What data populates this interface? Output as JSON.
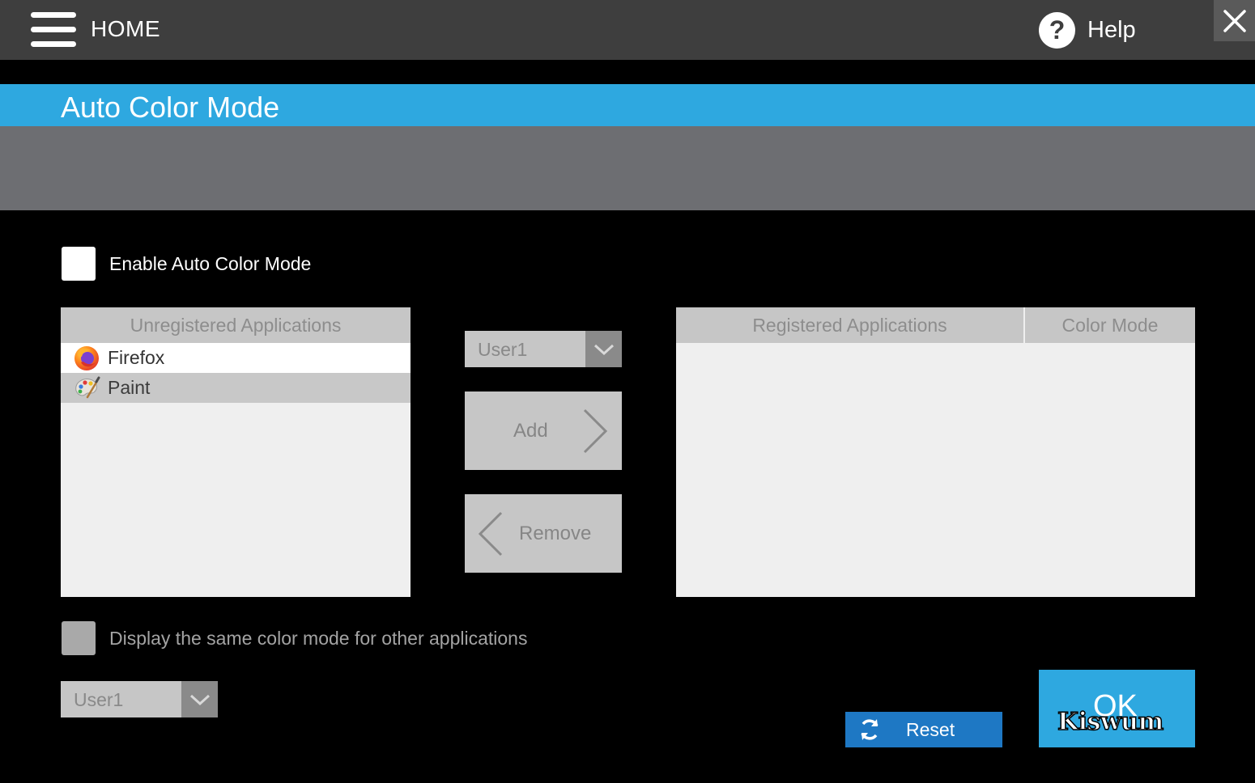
{
  "topbar": {
    "home_label": "HOME",
    "help_label": "Help",
    "help_icon_glyph": "?"
  },
  "title": "Auto Color Mode",
  "enable_checkbox": {
    "label": "Enable Auto Color Mode",
    "checked": false
  },
  "unregistered": {
    "header": "Unregistered Applications",
    "items": [
      {
        "label": "Firefox",
        "icon": "firefox-icon",
        "selected": true
      },
      {
        "label": "Paint",
        "icon": "paint-icon",
        "selected": false
      }
    ]
  },
  "user_dropdown": {
    "value": "User1"
  },
  "add_button": {
    "label": "Add"
  },
  "remove_button": {
    "label": "Remove"
  },
  "registered": {
    "header_apps": "Registered Applications",
    "header_mode": "Color Mode",
    "items": []
  },
  "same_mode_checkbox": {
    "label": "Display the same color mode for other applications",
    "checked": false
  },
  "bottom_dropdown": {
    "value": "User1"
  },
  "reset_button": {
    "label": "Reset"
  },
  "ok_button": {
    "label": "OK"
  },
  "watermark": "Kiswum",
  "colors": {
    "accent": "#2ea8e0",
    "reset": "#1e78c4",
    "topbar": "#3e3e3e",
    "band": "#6d6e72"
  }
}
